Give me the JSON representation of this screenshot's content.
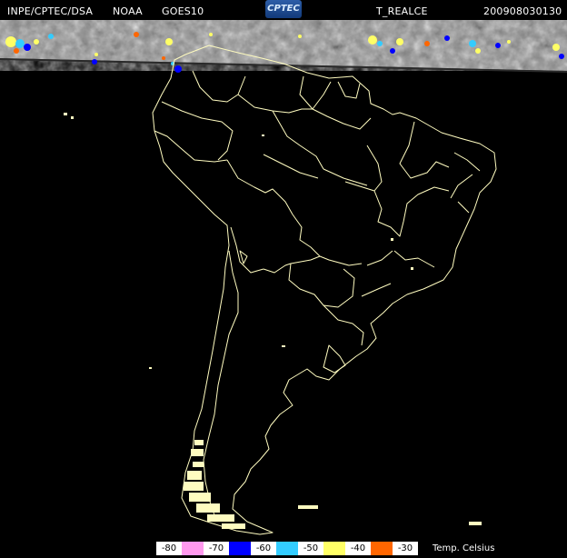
{
  "header": {
    "source": "INPE/CPTEC/DSA",
    "agency": "NOAA",
    "satellite": "GOES10",
    "logo_text": "CPTEC",
    "product": "T_REALCE",
    "timestamp": "200908030130"
  },
  "legend": {
    "title": "Temp. Celsius",
    "entries": [
      {
        "label": "-80",
        "color": "#ff99ee"
      },
      {
        "label": "-70",
        "color": "#0000ff"
      },
      {
        "label": "-60",
        "color": "#33ccff"
      },
      {
        "label": "-50",
        "color": "#ffff66"
      },
      {
        "label": "-40",
        "color": "#ff6600"
      },
      {
        "label": "-30",
        "color": null
      }
    ]
  },
  "colors": {
    "background": "#000000",
    "coastline": "#fffcc0",
    "cloud_band": "#8a8a8a"
  }
}
